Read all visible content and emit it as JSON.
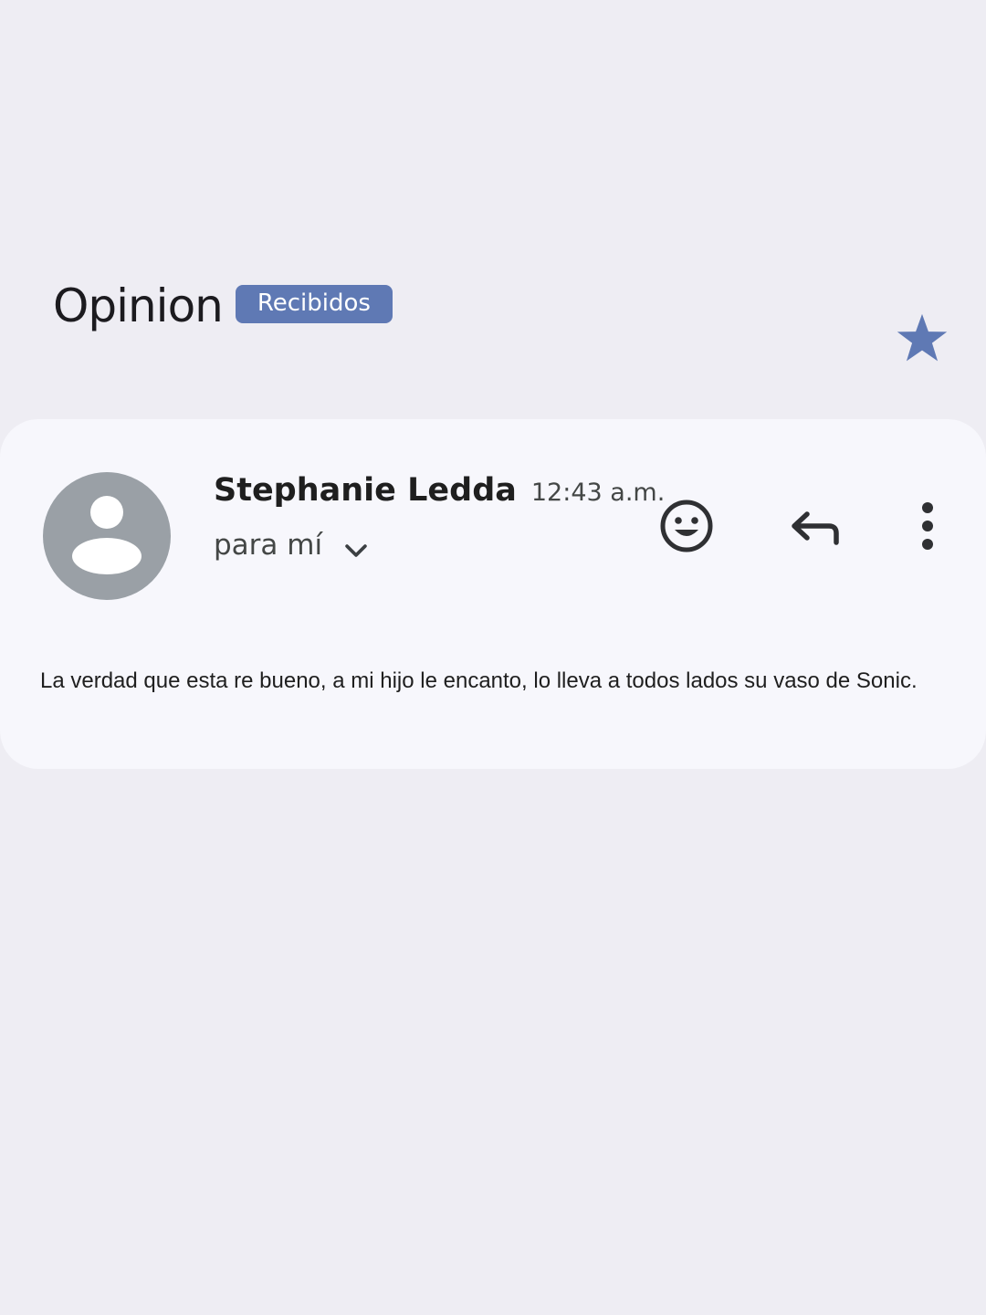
{
  "header": {
    "subject": "Opinion",
    "label": "Recibidos",
    "star_icon": "star-icon",
    "star_color": "#5f79b4"
  },
  "message": {
    "sender": "Stephanie Ledda",
    "time": "12:43 a.m.",
    "recipient": "para mí",
    "avatar_icon": "person-icon",
    "actions": [
      {
        "name": "emoji-react",
        "icon": "smiley-icon"
      },
      {
        "name": "reply",
        "icon": "reply-arrow-icon"
      },
      {
        "name": "more-options",
        "icon": "more-vert-icon"
      }
    ],
    "body": "La verdad que esta re bueno, a mi hijo le encanto, lo lleva a todos lados su vaso de Sonic."
  },
  "colors": {
    "background": "#eeedf3",
    "card": "#f7f7fc",
    "accent": "#5f79b4",
    "avatar": "#9aa0a6"
  }
}
